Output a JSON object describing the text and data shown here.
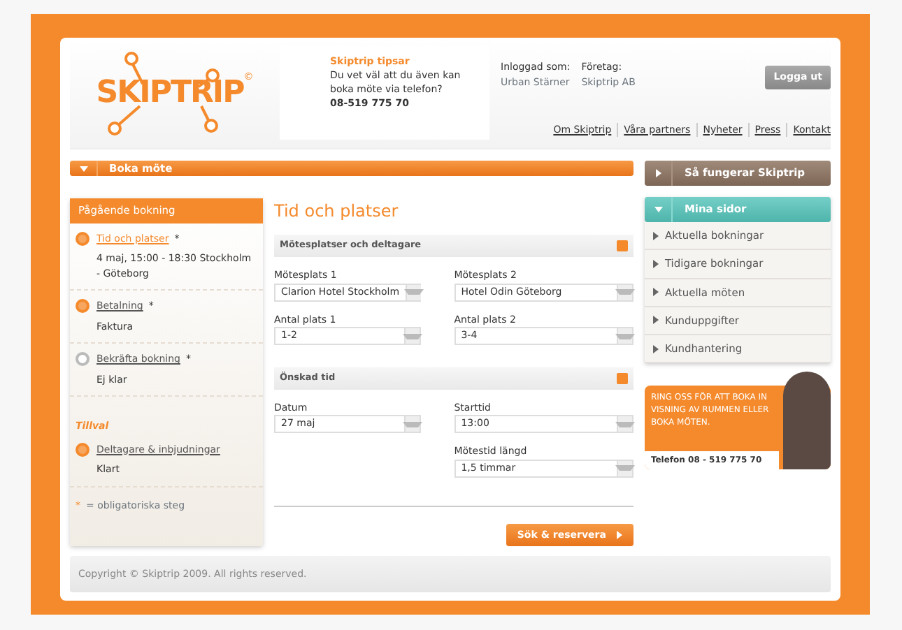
{
  "header": {
    "logo": "SKIPTRIP",
    "logo_mark": "©",
    "tip": {
      "title": "Skiptrip tipsar",
      "text": "Du vet väl att du även kan boka möte via telefon?",
      "phone": "08-519 775 70"
    },
    "user": {
      "label": "Inloggad som:",
      "value": "Urban Stärner"
    },
    "company": {
      "label": "Företag:",
      "value": "Skiptrip AB"
    },
    "logout": "Logga ut",
    "links": [
      "Om Skiptrip",
      "Våra partners",
      "Nyheter",
      "Press",
      "Kontakt"
    ]
  },
  "book_bar": {
    "label": "Boka möte",
    "expanded": true
  },
  "booking": {
    "title": "Pågående bokning",
    "steps": [
      {
        "label": "Tid och platser",
        "required": "*",
        "detail": "4 maj, 15:00 - 18:30 Stockholm - Göteborg",
        "checked": true,
        "selected": true
      },
      {
        "label": "Betalning",
        "required": "*",
        "detail": "Faktura",
        "checked": true,
        "selected": false
      },
      {
        "label": "Bekräfta bokning",
        "required": "*",
        "detail": "Ej klar",
        "checked": false,
        "selected": false
      }
    ],
    "extras_title": "Tillval",
    "extras": [
      {
        "label": "Deltagare & inbjudningar",
        "detail": "Klart",
        "checked": true
      }
    ],
    "legend_mark": "*",
    "legend": "= obligatoriska steg"
  },
  "main": {
    "title": "Tid och platser",
    "sections": [
      {
        "title": "Mötesplatser och deltagare",
        "left_fields": [
          {
            "label": "Mötesplats 1",
            "value": "Clarion Hotel Stockholm"
          },
          {
            "label": "Antal plats 1",
            "value": "1-2"
          }
        ],
        "right_fields": [
          {
            "label": "Mötesplats 2",
            "value": "Hotel Odin Göteborg"
          },
          {
            "label": "Antal plats 2",
            "value": "3-4"
          }
        ]
      },
      {
        "title": "Önskad tid",
        "left_fields": [
          {
            "label": "Datum",
            "value": "27 maj"
          }
        ],
        "right_fields": [
          {
            "label": "Starttid",
            "value": "13:00"
          },
          {
            "label": "Mötestid längd",
            "value": "1,5 timmar"
          }
        ]
      }
    ],
    "submit": "Sök & reservera"
  },
  "right": {
    "how": {
      "label": "Så fungerar Skiptrip",
      "expanded": false
    },
    "my_pages": {
      "label": "Mina sidor",
      "expanded": true,
      "items": [
        "Aktuella bokningar",
        "Tidigare bokningar",
        "Aktuella möten",
        "Kunduppgifter",
        "Kundhantering"
      ]
    },
    "promo": {
      "text": "RING OSS FÖR ATT BOKA IN VISNING AV RUMMEN ELLER BOKA MÖTEN.",
      "phone": "Telefon 08 - 519 775 70"
    }
  },
  "footer": "Copyright © Skiptrip 2009. All rights reserved."
}
